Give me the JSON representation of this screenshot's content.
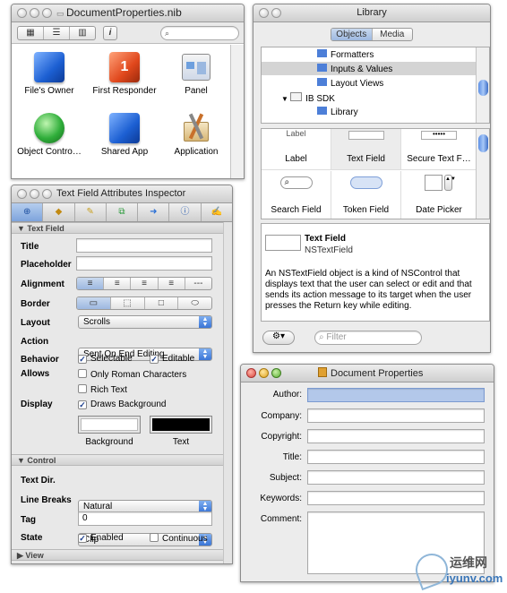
{
  "nib": {
    "title": "DocumentProperties.nib",
    "items": [
      {
        "label": "File's Owner",
        "icon": "cube-icon",
        "color": "#2a6fd6"
      },
      {
        "label": "First Responder",
        "icon": "cube-icon",
        "color": "#d9431e"
      },
      {
        "label": "Panel",
        "icon": "window-icon",
        "color": "#4a8ad8"
      },
      {
        "label": "Object Contro…",
        "icon": "sphere-icon",
        "color": "#2fae3a"
      },
      {
        "label": "Shared App",
        "icon": "cube-icon",
        "color": "#2a6fd6"
      },
      {
        "label": "Application",
        "icon": "application-icon",
        "color": "#c8702a"
      }
    ]
  },
  "library": {
    "title": "Library",
    "tab_objects": "Objects",
    "tab_media": "Media",
    "tree": [
      "Formatters",
      "Inputs & Values",
      "Layout Views",
      "IB SDK",
      "Library"
    ],
    "grid_row1": [
      "Label",
      "Text Field",
      "Secure Text F…"
    ],
    "grid_row2": [
      "Search Field",
      "Token Field",
      "Date Picker"
    ],
    "detail_title": "Text Field",
    "detail_class": "NSTextField",
    "description": "An NSTextField object is a kind of NSControl that displays text that the user can select or edit and that sends its action message to its target when the user presses the Return key while editing.",
    "filter_placeholder": "Filter",
    "secure_dots": "•••••"
  },
  "inspector": {
    "title": "Text Field Attributes Inspector",
    "section_text_field": "Text Field",
    "title_label": "Title",
    "placeholder_label": "Placeholder",
    "alignment_label": "Alignment",
    "border_label": "Border",
    "layout_label": "Layout",
    "layout_value": "Scrolls",
    "action_label": "Action",
    "action_value": "Sent On End Editing",
    "behavior_label": "Behavior",
    "selectable": "Selectable",
    "editable": "Editable",
    "allows_label": "Allows",
    "only_roman": "Only Roman Characters",
    "rich_text": "Rich Text",
    "display_label": "Display",
    "draws_background": "Draws Background",
    "background_label": "Background",
    "text_label": "Text",
    "section_control": "Control",
    "text_dir_label": "Text Dir.",
    "text_dir_value": "Natural",
    "line_breaks_label": "Line Breaks",
    "line_breaks_value": "Clip",
    "tag_label": "Tag",
    "tag_value": "0",
    "state_label": "State",
    "enabled": "Enabled",
    "continuous": "Continuous",
    "section_view": "View",
    "alignment_options": [
      "left-align",
      "center-align",
      "right-align",
      "justify",
      "---"
    ],
    "border_options": [
      "none",
      "line",
      "bezel",
      "rounded"
    ]
  },
  "doc_props": {
    "title": "Document Properties",
    "fields": [
      "Author:",
      "Company:",
      "Copyright:",
      "Title:",
      "Subject:",
      "Keywords:",
      "Comment:"
    ]
  },
  "watermark": {
    "cn": "运维网",
    "url": "iyunv.com"
  }
}
